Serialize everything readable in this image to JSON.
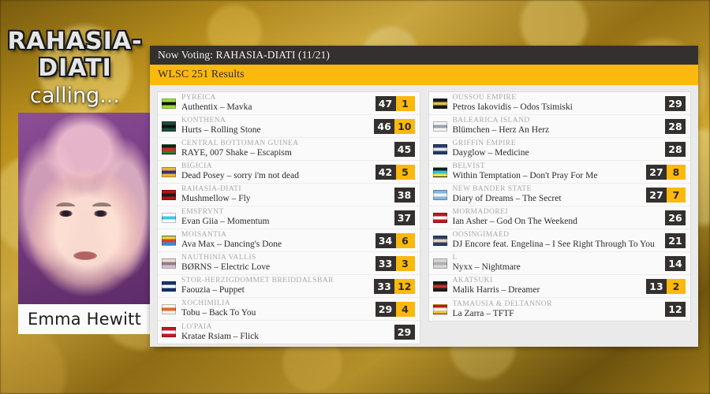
{
  "left_panel": {
    "logo_line1": "RAHASIA-",
    "logo_line2": "DIATI",
    "logo_tagline": "calling...",
    "artist_name": "Emma Hewitt"
  },
  "header": {
    "now_voting": "Now Voting: RAHASIA-DIATI (11/21)",
    "results_title": "WLSC 251 Results"
  },
  "columns": [
    {
      "rows": [
        {
          "country": "PYREICA",
          "song": "Authentix – Mavka",
          "points": "47",
          "bonus": "1",
          "flag": "#9be03a|#111111|#9be03a"
        },
        {
          "country": "KONTHENA",
          "song": "Hurts – Rolling Stone",
          "points": "46",
          "bonus": "10",
          "flag": "#1f4d3a|#111111|#1f4d3a"
        },
        {
          "country": "CENTRAL BOTTOMAN GUINEA",
          "song": "RAYE, 007 Shake – Escapism",
          "points": "45",
          "bonus": "",
          "flag": "#1b1b1b|#cf2a1e|#2f7d33"
        },
        {
          "country": "BIGICIA",
          "song": "Dead Posey – sorry i'm not dead",
          "points": "42",
          "bonus": "5",
          "flag": "#e8b43a|#3b2a86|#e8b43a"
        },
        {
          "country": "RAHASIA-DIATI",
          "song": "Mushmellow – Fly",
          "points": "38",
          "bonus": "",
          "flag": "#b01414|#1a1a1a|#b01414"
        },
        {
          "country": "EMSFRYNT",
          "song": "Evan Giia – Momentum",
          "points": "37",
          "bonus": "",
          "flag": "#ffffff|#3ec6e0|#ffffff"
        },
        {
          "country": "MOISANTIA",
          "song": "Ava Max – Dancing's Done",
          "points": "34",
          "bonus": "6",
          "flag": "#f2d024|#e33a2e|#2f8fd0"
        },
        {
          "country": "NAUTHINIA VALLIS",
          "song": "BØRNS – Electric Love",
          "points": "33",
          "bonus": "3",
          "flag": "#e8e0dc|#9d7a86|#cfc4d4"
        },
        {
          "country": "STOR-HERZIGDÖMMET BREIDDALSBAR",
          "song": "Faouzia – Puppet",
          "points": "33",
          "bonus": "12",
          "flag": "#17316b|#ffffff|#17316b"
        },
        {
          "country": "XOCHIMILIA",
          "song": "Tobu – Back To You",
          "points": "29",
          "bonus": "4",
          "flag": "#f6f2ec|#e06a2a|#f6f2ec"
        },
        {
          "country": "LO'PAIA",
          "song": "Kratae Rsiam – Flick",
          "points": "29",
          "bonus": "",
          "flag": "#c0172a|#ffffff|#c0172a"
        }
      ]
    },
    {
      "rows": [
        {
          "country": "OUSSOU EMPIRE",
          "song": "Petros Iakovidis – Odos Tsimiski",
          "points": "29",
          "bonus": "",
          "flag": "#1a1a1a|#e0c04a|#1a1a1a"
        },
        {
          "country": "BALEARICA ISLAND",
          "song": "Blümchen – Herz An Herz",
          "points": "28",
          "bonus": "",
          "flag": "#f4f4f4|#9aa3ab|#f4f4f4"
        },
        {
          "country": "GRIFFIN EMPIRE",
          "song": "Dayglow – Medicine",
          "points": "28",
          "bonus": "",
          "flag": "#243a6b|#e8e8e8|#243a6b"
        },
        {
          "country": "BELVIST",
          "song": "Within Temptation – Don't Pray For Me",
          "points": "27",
          "bonus": "8",
          "flag": "#1a1a1a|#2ec4d8|#f2e23a"
        },
        {
          "country": "NEW BANDER STATE",
          "song": "Diary of Dreams – The Secret",
          "points": "27",
          "bonus": "7",
          "flag": "#7fb8de|#f2f2f2|#7fb8de"
        },
        {
          "country": "MORMADOREI",
          "song": "Ian Asher – God On The Weekend",
          "points": "26",
          "bonus": "",
          "flag": "#c21622|#ffffff|#c21622"
        },
        {
          "country": "ÖÖSINGIMÄED",
          "song": "DJ Encore feat. Engelina – I See Right Through To You",
          "points": "21",
          "bonus": "",
          "flag": "#2a3f66|#e8d2c2|#2a3f66"
        },
        {
          "country": "L",
          "song": "Nyxx – Nightmare",
          "points": "14",
          "bonus": "",
          "flag": "#d8d8d8|#b0b0b0|#d8d8d8"
        },
        {
          "country": "AKATSUKI",
          "song": "Malik Harris – Dreamer",
          "points": "13",
          "bonus": "2",
          "flag": "#1a1a1a|#cf2b2b|#1a1a1a"
        },
        {
          "country": "TAMAUSIA & DELTANNOR",
          "song": "La Zarra – TFTF",
          "points": "12",
          "bonus": "",
          "flag": "#c21622|#f0f0f0|#e8c428"
        }
      ]
    }
  ],
  "colors": {
    "accent": "#fbb80d",
    "dark": "#33302e",
    "panel": "#eaeaea"
  }
}
